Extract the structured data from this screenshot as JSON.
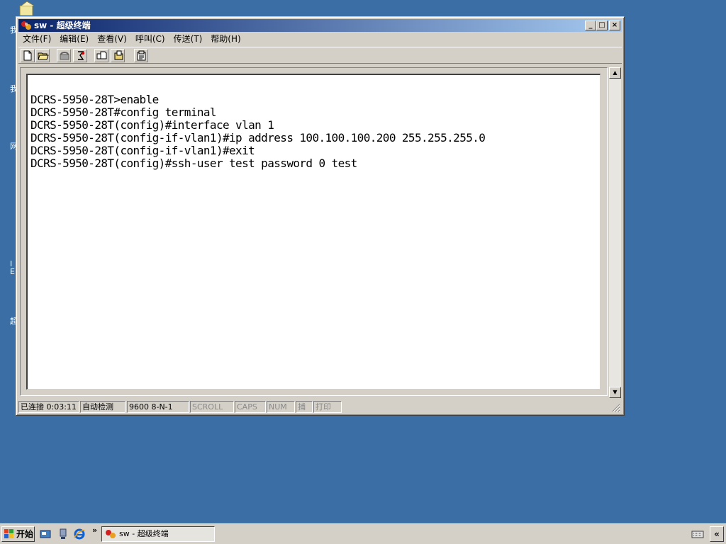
{
  "window": {
    "title": "sw - 超级终端",
    "controls": {
      "minimize": "_",
      "maximize": "□",
      "close": "×"
    }
  },
  "menu": [
    "文件(F)",
    "编辑(E)",
    "查看(V)",
    "呼叫(C)",
    "传送(T)",
    "帮助(H)"
  ],
  "toolbar": [
    "new-connection",
    "open",
    "disconnect",
    "dial",
    "send",
    "receive",
    "properties"
  ],
  "terminal": {
    "lines": [
      "DCRS-5950-28T>enable",
      "DCRS-5950-28T#config terminal",
      "DCRS-5950-28T(config)#interface vlan 1",
      "DCRS-5950-28T(config-if-vlan1)#ip address 100.100.100.200 255.255.255.0",
      "DCRS-5950-28T(config-if-vlan1)#exit",
      "DCRS-5950-28T(config)#ssh-user test password 0 test"
    ]
  },
  "statusbar": {
    "connection": "已连接 0:03:11",
    "detect": "自动检测",
    "params": "9600 8-N-1",
    "scroll": "SCROLL",
    "caps": "CAPS",
    "num": "NUM",
    "capture": "捕",
    "print": "打印"
  },
  "desktop": {
    "icon_labels": [
      "我",
      "我",
      "网",
      "I",
      "E",
      "超"
    ]
  },
  "taskbar": {
    "start": "开始",
    "more": "»",
    "task": "sw - 超级终端",
    "tray_expand": "«"
  },
  "colors": {
    "desktop": "#3a6ea5",
    "titlebar_start": "#0a246a",
    "titlebar_end": "#a6caf0",
    "face": "#d4d0c8"
  }
}
